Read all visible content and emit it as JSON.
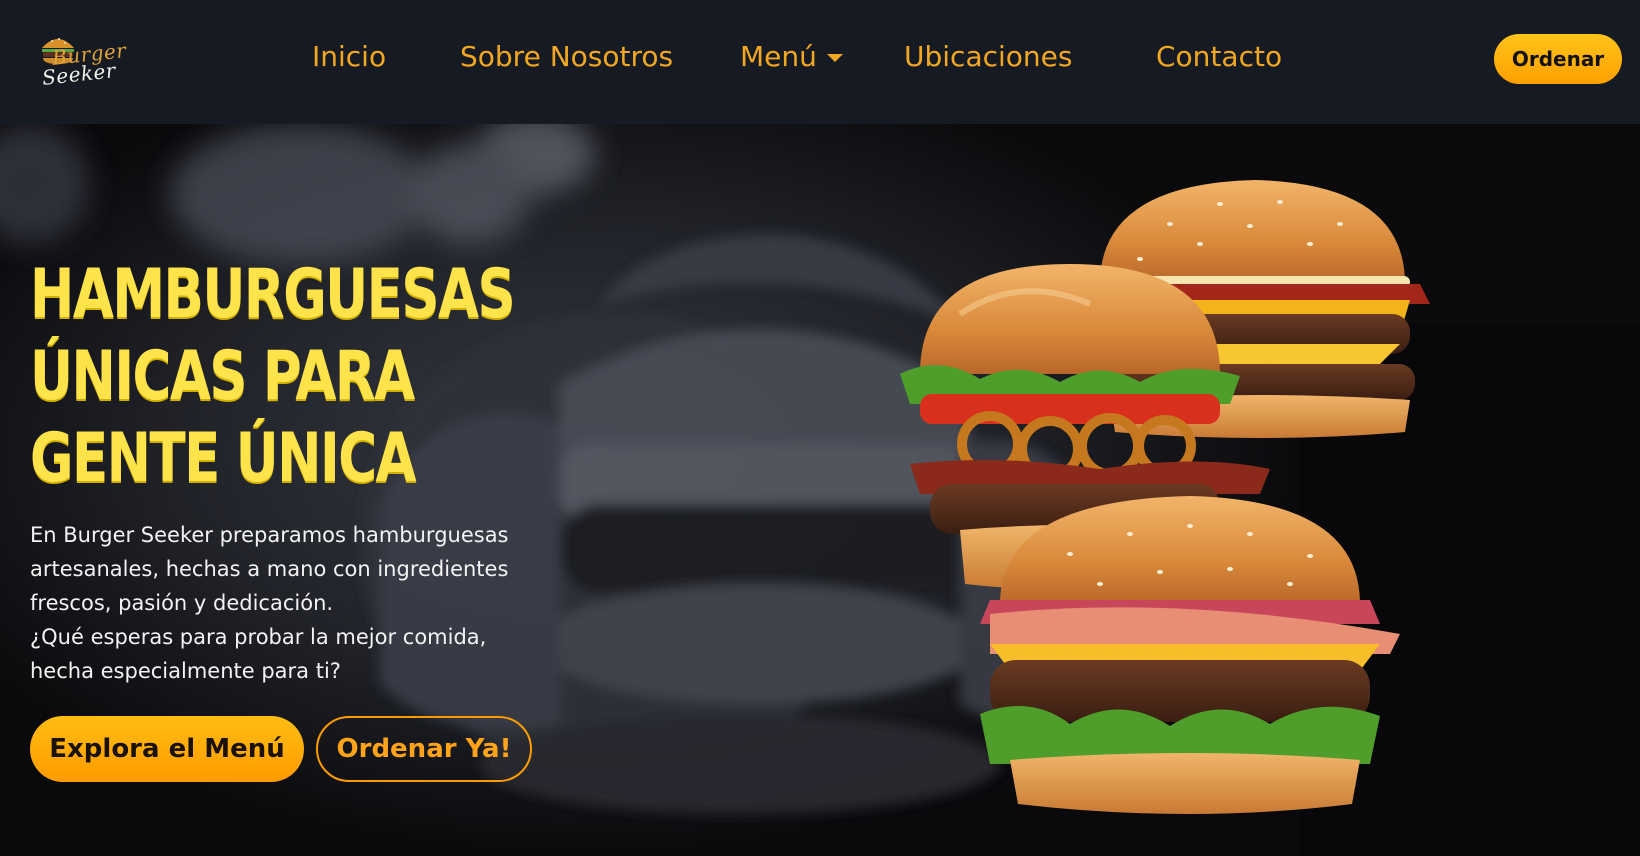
{
  "brand": {
    "logo_line1": "Burger",
    "logo_line2": "Seeker"
  },
  "nav": {
    "items": [
      {
        "label": "Inicio"
      },
      {
        "label": "Sobre Nosotros"
      },
      {
        "label": "Menú"
      },
      {
        "label": "Ubicaciones"
      },
      {
        "label": "Contacto"
      }
    ],
    "order_label": "Ordenar"
  },
  "hero": {
    "title_lines": [
      "HAMBURGUESAS",
      "ÚNICAS PARA",
      "GENTE ÚNICA"
    ],
    "description_lines": [
      "En Burger Seeker preparamos hamburguesas",
      "artesanales, hechas a mano con ingredientes",
      "frescos, pasión y dedicación.",
      "¿Qué esperas para probar la mejor comida,",
      "hecha especialmente para ti?"
    ],
    "primary_cta": "Explora el Menú",
    "secondary_cta": "Ordenar Ya!"
  },
  "colors": {
    "accent": "#ffa41a",
    "title": "#ffe34a",
    "nav_bg": "#161a22",
    "hero_bg": "#0a0a0c"
  },
  "icons": {
    "menu_dropdown": "chevron-down-icon",
    "logo": "burger-logo-icon"
  }
}
